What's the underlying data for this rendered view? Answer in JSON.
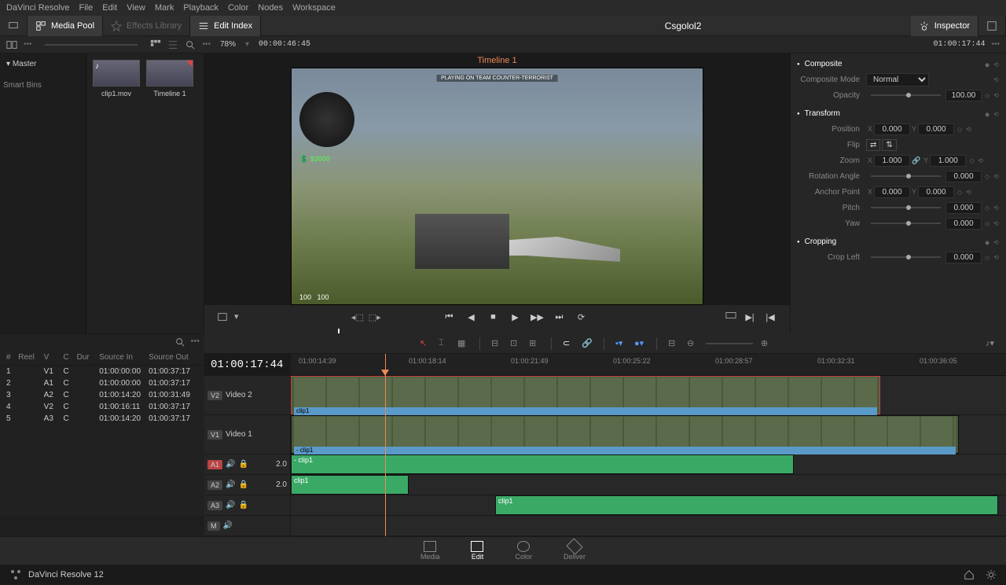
{
  "menubar": [
    "DaVinci Resolve",
    "File",
    "Edit",
    "View",
    "Mark",
    "Playback",
    "Color",
    "Nodes",
    "Workspace"
  ],
  "toolbar": {
    "mediapool": "Media Pool",
    "effects": "Effects Library",
    "editindex": "Edit Index",
    "project": "Csgolol2",
    "inspector": "Inspector"
  },
  "viewerbar": {
    "zoom": "78%",
    "duration": "00:00:46:45",
    "timeline_name": "Timeline 1",
    "timecode": "01:00:17:44"
  },
  "pool": {
    "master": "Master",
    "smartbins": "Smart Bins",
    "clips": [
      "clip1.mov",
      "Timeline 1"
    ]
  },
  "inspector_data": {
    "composite": "Composite",
    "composite_mode_label": "Composite Mode",
    "composite_mode": "Normal",
    "opacity_label": "Opacity",
    "opacity": "100.00",
    "transform": "Transform",
    "position": "Position",
    "pos_x": "0.000",
    "pos_y": "0.000",
    "flip": "Flip",
    "zoom": "Zoom",
    "zoom_x": "1.000",
    "zoom_y": "1.000",
    "rotation": "Rotation Angle",
    "rotation_v": "0.000",
    "anchor": "Anchor Point",
    "anchor_x": "0.000",
    "anchor_y": "0.000",
    "pitch": "Pitch",
    "pitch_v": "0.000",
    "yaw": "Yaw",
    "yaw_v": "0.000",
    "cropping": "Cropping",
    "crop_left": "Crop Left",
    "crop_left_v": "0.000"
  },
  "editindex": {
    "cols": [
      "#",
      "Reel",
      "V",
      "C",
      "Dur",
      "Source In",
      "Source Out"
    ],
    "rows": [
      {
        "n": "1",
        "v": "V1",
        "c": "C",
        "in": "01:00:00:00",
        "out": "01:00:37:17"
      },
      {
        "n": "2",
        "v": "A1",
        "c": "C",
        "in": "01:00:00:00",
        "out": "01:00:37:17"
      },
      {
        "n": "3",
        "v": "A2",
        "c": "C",
        "in": "01:00:14:20",
        "out": "01:00:31:49"
      },
      {
        "n": "4",
        "v": "V2",
        "c": "C",
        "in": "01:00:16:11",
        "out": "01:00:37:17"
      },
      {
        "n": "5",
        "v": "A3",
        "c": "C",
        "in": "01:00:14:20",
        "out": "01:00:37:17"
      }
    ]
  },
  "timeline": {
    "timecode": "01:00:17:44",
    "ruler": [
      "01:00:14:39",
      "01:00:18:14",
      "01:00:21:49",
      "01:00:25:22",
      "01:00:28:57",
      "01:00:32:31",
      "01:00:36:05"
    ],
    "tracks": {
      "v2": "Video 2",
      "v1": "Video 1",
      "a1_level": "2.0",
      "a2_level": "2.0"
    },
    "badges": {
      "v2": "V2",
      "v1": "V1",
      "a1": "A1",
      "a2": "A2",
      "a3": "A3",
      "m": "M"
    },
    "clip_label": "clip1",
    "clip_label_v1": "- clip1",
    "clip_label_a1": "- clip1"
  },
  "bottom_tabs": [
    "Media",
    "Edit",
    "Color",
    "Deliver"
  ],
  "footer": "DaVinci Resolve 12",
  "game_overlay": {
    "money": "$3000",
    "hud": "PLAYING ON TEAM COUNTER-TERRORIST",
    "health": "100",
    "armor": "100"
  }
}
